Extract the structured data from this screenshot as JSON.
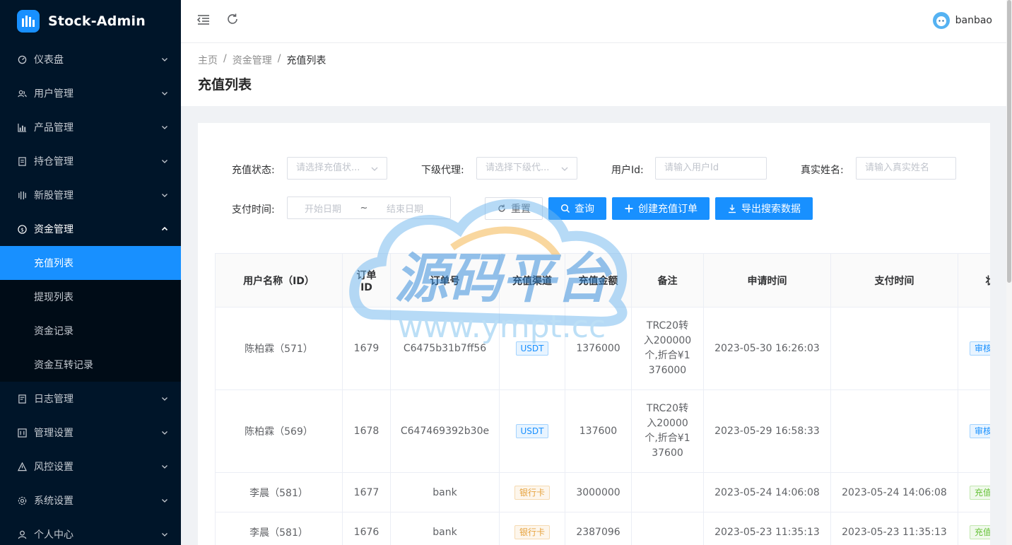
{
  "app": {
    "name": "Stock-Admin"
  },
  "colors": {
    "sidebar_bg": "#001529",
    "accent": "#1890ff"
  },
  "sidebar": {
    "items": [
      {
        "label": "仪表盘",
        "icon": "dashboard-icon"
      },
      {
        "label": "用户管理",
        "icon": "users-icon"
      },
      {
        "label": "产品管理",
        "icon": "chart-icon"
      },
      {
        "label": "持仓管理",
        "icon": "position-icon"
      },
      {
        "label": "新股管理",
        "icon": "ipo-icon"
      },
      {
        "label": "资金管理",
        "icon": "dollar-icon",
        "open": true,
        "children": [
          {
            "label": "充值列表",
            "active": true
          },
          {
            "label": "提现列表"
          },
          {
            "label": "资金记录"
          },
          {
            "label": "资金互转记录"
          }
        ]
      },
      {
        "label": "日志管理",
        "icon": "log-icon"
      },
      {
        "label": "管理设置",
        "icon": "manage-icon"
      },
      {
        "label": "风控设置",
        "icon": "warning-icon"
      },
      {
        "label": "系统设置",
        "icon": "settings-icon"
      },
      {
        "label": "个人中心",
        "icon": "user-icon"
      }
    ]
  },
  "header": {
    "username": "banbao"
  },
  "breadcrumb": {
    "items": [
      "主页",
      "资金管理",
      "充值列表"
    ],
    "separator": "/"
  },
  "page": {
    "title": "充值列表"
  },
  "filters": {
    "status": {
      "label": "充值状态:",
      "placeholder": "请选择充值状..."
    },
    "agent": {
      "label": "下级代理:",
      "placeholder": "请选择下级代..."
    },
    "user_id": {
      "label": "用户Id:",
      "placeholder": "请输入用户Id"
    },
    "real_name": {
      "label": "真实姓名:",
      "placeholder": "请输入真实姓名"
    },
    "pay_time": {
      "label": "支付时间:",
      "start_placeholder": "开始日期",
      "range_separator": "~",
      "end_placeholder": "结束日期"
    }
  },
  "buttons": {
    "reset": "重置",
    "search": "查询",
    "create": "创建充值订单",
    "export": "导出搜索数据"
  },
  "table": {
    "columns": [
      "用户名称（ID）",
      "订单\nID",
      "订单号",
      "充值渠道",
      "充值金额",
      "备注",
      "申请时间",
      "支付时间",
      "状态"
    ],
    "rows": [
      {
        "user": "陈柏霖（571）",
        "id": "1679",
        "order_no": "C6475b31b7ff56",
        "channel": "USDT",
        "channel_type": "blue",
        "amount": "1376000",
        "remark": "TRC20转入200000个,折合¥1376000",
        "apply_time": "2023-05-30 16:26:03",
        "pay_time": "",
        "status": "审核中",
        "status_type": "blue"
      },
      {
        "user": "陈柏霖（569）",
        "id": "1678",
        "order_no": "C647469392b30e",
        "channel": "USDT",
        "channel_type": "blue",
        "amount": "137600",
        "remark": "TRC20转入20000个,折合¥137600",
        "apply_time": "2023-05-29 16:58:33",
        "pay_time": "",
        "status": "审核中",
        "status_type": "blue"
      },
      {
        "user": "李晨（581）",
        "id": "1677",
        "order_no": "bank",
        "channel": "银行卡",
        "channel_type": "orange",
        "amount": "3000000",
        "remark": "",
        "apply_time": "2023-05-24 14:06:08",
        "pay_time": "2023-05-24 14:06:08",
        "status": "充值成功",
        "status_type": "green"
      },
      {
        "user": "李晨（581）",
        "id": "1676",
        "order_no": "bank",
        "channel": "银行卡",
        "channel_type": "orange",
        "amount": "2387096",
        "remark": "",
        "apply_time": "2023-05-23 11:35:13",
        "pay_time": "2023-05-23 11:35:13",
        "status": "充值成功",
        "status_type": "green"
      }
    ]
  },
  "watermark": {
    "title": "源码平台",
    "url": "www.ympt.cc"
  }
}
